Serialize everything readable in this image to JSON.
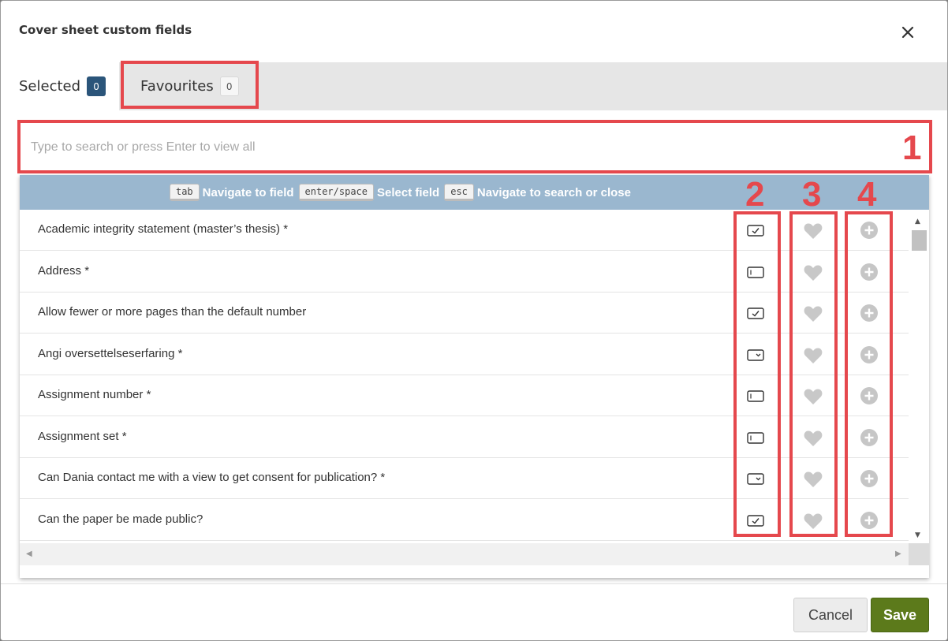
{
  "dialog": {
    "title": "Cover sheet custom fields",
    "close_icon": "close-icon"
  },
  "tabs": [
    {
      "label": "Selected",
      "count": "0",
      "active": true
    },
    {
      "label": "Favourites",
      "count": "0",
      "active": false
    }
  ],
  "search": {
    "placeholder": "Type to search or press Enter to view all",
    "value": ""
  },
  "hints": [
    {
      "key": "tab",
      "text": "Navigate to field"
    },
    {
      "key": "enter/space",
      "text": "Select field"
    },
    {
      "key": "esc",
      "text": "Navigate to search or close"
    }
  ],
  "fields": [
    {
      "label": "Academic integrity statement (master’s thesis) *",
      "type_icon": "checkbox-field-icon"
    },
    {
      "label": "Address *",
      "type_icon": "text-field-icon"
    },
    {
      "label": "Allow fewer or more pages than the default number",
      "type_icon": "checkbox-field-icon"
    },
    {
      "label": "Angi oversettelseserfaring *",
      "type_icon": "dropdown-field-icon"
    },
    {
      "label": "Assignment number *",
      "type_icon": "text-field-icon"
    },
    {
      "label": "Assignment set *",
      "type_icon": "text-field-icon"
    },
    {
      "label": "Can Dania contact me with a view to get consent for publication? *",
      "type_icon": "dropdown-field-icon"
    },
    {
      "label": "Can the paper be made public?",
      "type_icon": "checkbox-field-icon"
    }
  ],
  "row_icons": {
    "favourite": "heart-icon",
    "add": "plus-circle-icon"
  },
  "annotations": [
    "1",
    "2",
    "3",
    "4"
  ],
  "footer": {
    "cancel_label": "Cancel",
    "save_label": "Save"
  },
  "colors": {
    "accent_save": "#5c7a1b",
    "badge_selected": "#2b557a",
    "hint_bar": "#9ab7cf",
    "annotation": "#e5484d"
  }
}
